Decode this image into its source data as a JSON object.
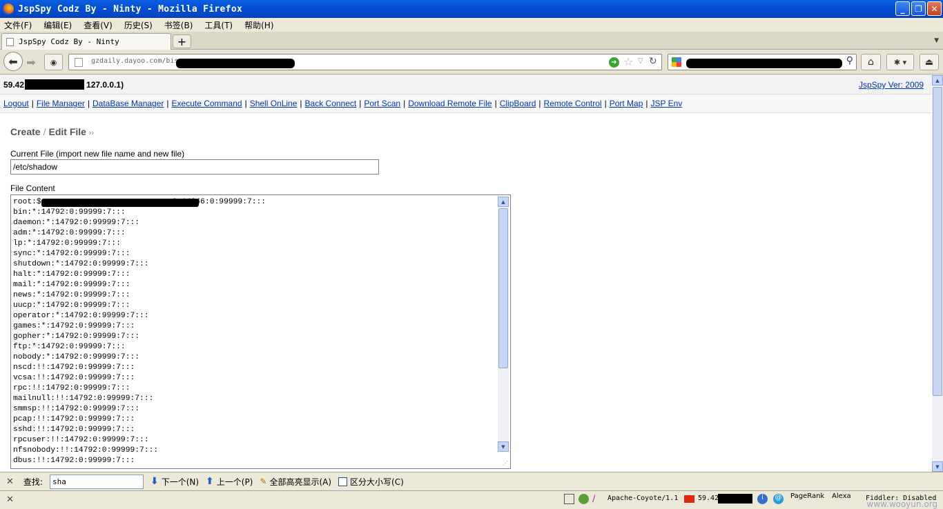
{
  "window": {
    "title": "JspSpy Codz By - Ninty - Mozilla Firefox",
    "buttons": [
      "_",
      "❐",
      "✕"
    ]
  },
  "menubar": [
    "文件(F)",
    "编辑(E)",
    "查看(V)",
    "历史(S)",
    "书签(B)",
    "工具(T)",
    "帮助(H)"
  ],
  "tab": {
    "title": "JspSpy Codz By - Ninty"
  },
  "navbar": {
    "url": "gzdaily.dayoo.com/bis"
  },
  "page": {
    "server_ip_prefix": "59.42",
    "server_ip_suffix": "127.0.0.1)",
    "version_link": "JspSpy Ver: 2009",
    "links": [
      "Logout",
      "File Manager",
      "DataBase Manager",
      "Execute Command",
      "Shell OnLine",
      "Back Connect",
      "Port Scan",
      "Download Remote File",
      "ClipBoard",
      "Remote Control",
      "Port Map",
      "JSP Env"
    ],
    "heading_create": "Create",
    "heading_slash": "/",
    "heading_edit": "Edit File",
    "heading_raquo": "››",
    "current_file_label": "Current File (import new file name and new file)",
    "current_file_value": "/etc/shadow",
    "file_content_label": "File Content",
    "file_lines": [
      "root:$                            0:14846:0:99999:7:::",
      "bin:*:14792:0:99999:7:::",
      "daemon:*:14792:0:99999:7:::",
      "adm:*:14792:0:99999:7:::",
      "lp:*:14792:0:99999:7:::",
      "sync:*:14792:0:99999:7:::",
      "shutdown:*:14792:0:99999:7:::",
      "halt:*:14792:0:99999:7:::",
      "mail:*:14792:0:99999:7:::",
      "news:*:14792:0:99999:7:::",
      "uucp:*:14792:0:99999:7:::",
      "operator:*:14792:0:99999:7:::",
      "games:*:14792:0:99999:7:::",
      "gopher:*:14792:0:99999:7:::",
      "ftp:*:14792:0:99999:7:::",
      "nobody:*:14792:0:99999:7:::",
      "nscd:!!:14792:0:99999:7:::",
      "vcsa:!!:14792:0:99999:7:::",
      "rpc:!!:14792:0:99999:7:::",
      "mailnull:!!:14792:0:99999:7:::",
      "smmsp:!!:14792:0:99999:7:::",
      "pcap:!!:14792:0:99999:7:::",
      "sshd:!!:14792:0:99999:7:::",
      "rpcuser:!!:14792:0:99999:7:::",
      "nfsnobody:!!:14792:0:99999:7:::",
      "dbus:!!:14792:0:99999:7:::"
    ]
  },
  "findbar": {
    "label": "查找:",
    "value": "sha",
    "next": "下一个(N)",
    "prev": "上一个(P)",
    "highlight": "全部高亮显示(A)",
    "match_case": "区分大小写(C)"
  },
  "statusbar": {
    "server": "Apache-Coyote/1.1",
    "ip_prefix": "59.42",
    "pagerank": "PageRank",
    "alexa": "Alexa",
    "fiddler": "Fiddler: Disabled",
    "watermark": "www.wooyun.org"
  },
  "colors": {
    "link": "#0033bb",
    "titlebar": "#0350d4"
  }
}
